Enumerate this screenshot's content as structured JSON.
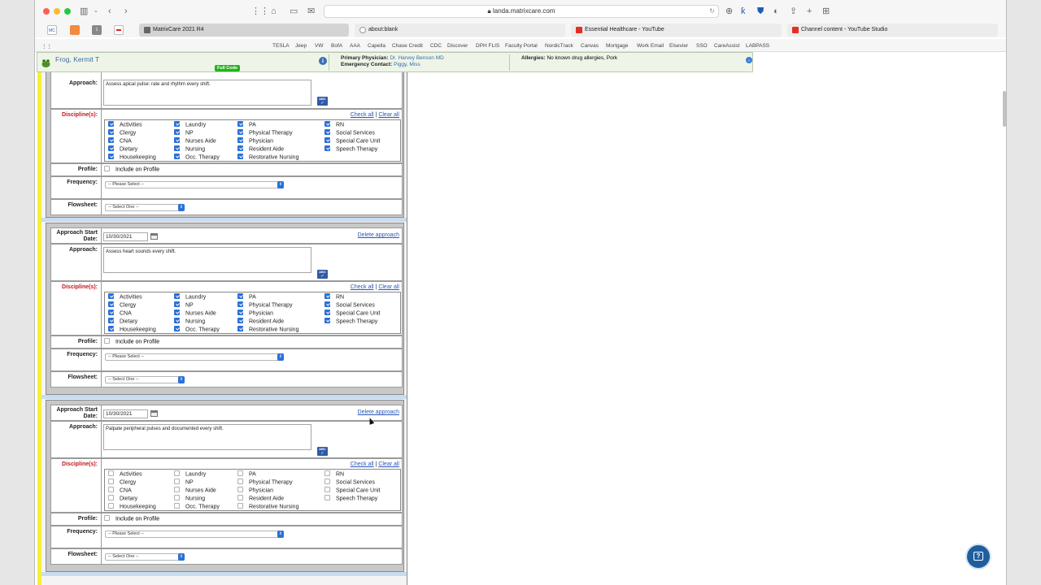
{
  "browser": {
    "url": "landa.matrixcare.com",
    "tabs": [
      {
        "label": "MatrixCare 2021 R4",
        "active": true
      },
      {
        "label": "about:blank",
        "active": false
      },
      {
        "label": "Essential Healthcare - YouTube",
        "active": false
      },
      {
        "label": "Channel content - YouTube Studio",
        "active": false
      }
    ],
    "pinned": [
      "MC",
      "",
      "1",
      ""
    ],
    "bookmarks": [
      "TESLA",
      "Jeep",
      "VW",
      "BofA",
      "AAA",
      "Capella",
      "Chase Credit",
      "CDC",
      "Discover",
      "DPH FLIS",
      "Faculty Portal",
      "NordicTrack",
      "Canvas",
      "Mortgage",
      "Work Email",
      "Elsevier",
      "SSO",
      "CareAssist",
      "LABPASS"
    ]
  },
  "banner": {
    "patient_name": "Frog, Kermit T",
    "code_badge": "Full Code",
    "physician_label": "Primary Physician:",
    "physician": "Dr. Harvey Benson MD",
    "emergency_label": "Emergency Contact:",
    "emergency": "Piggy, Miss",
    "allergies_label": "Allergies:",
    "allergies": "No known drug allergies, Pork"
  },
  "labels": {
    "approach_start": "Approach Start Date:",
    "approach": "Approach:",
    "disciplines": "Discipline(s):",
    "profile": "Profile:",
    "frequency": "Frequency:",
    "flowsheet": "Flowsheet:",
    "include_profile": "Include on Profile",
    "check_all": "Check all",
    "clear_all": "Clear all",
    "separator": "|",
    "delete_approach": "Delete approach",
    "freq_placeholder": "-- Please Select --",
    "flow_placeholder": "-- Select One --"
  },
  "approaches": [
    {
      "start_date": "",
      "text": "Assess apical pulse: rate and rhythm every shift.",
      "all_checked": true
    },
    {
      "start_date": "10/30/2021",
      "text": "Assess heart sounds every shift.",
      "all_checked": true
    },
    {
      "start_date": "10/30/2021",
      "text": "Palpate peripheral pulses and documented every shift.",
      "all_checked": false
    }
  ],
  "disciplines": [
    [
      "Activities",
      "Clergy",
      "CNA",
      "Dietary",
      "Housekeeping"
    ],
    [
      "Laundry",
      "NP",
      "Nurses Aide",
      "Nursing",
      "Occ. Therapy"
    ],
    [
      "PA",
      "Physical Therapy",
      "Physician",
      "Resident Aide",
      "Restorative Nursing"
    ],
    [
      "RN",
      "Social Services",
      "Special Care Unit",
      "Speech Therapy"
    ]
  ],
  "colors": {
    "accent": "#2a70d8",
    "required_label": "#c0181e",
    "link": "#2a57b8",
    "full_code": "#22b31b"
  }
}
